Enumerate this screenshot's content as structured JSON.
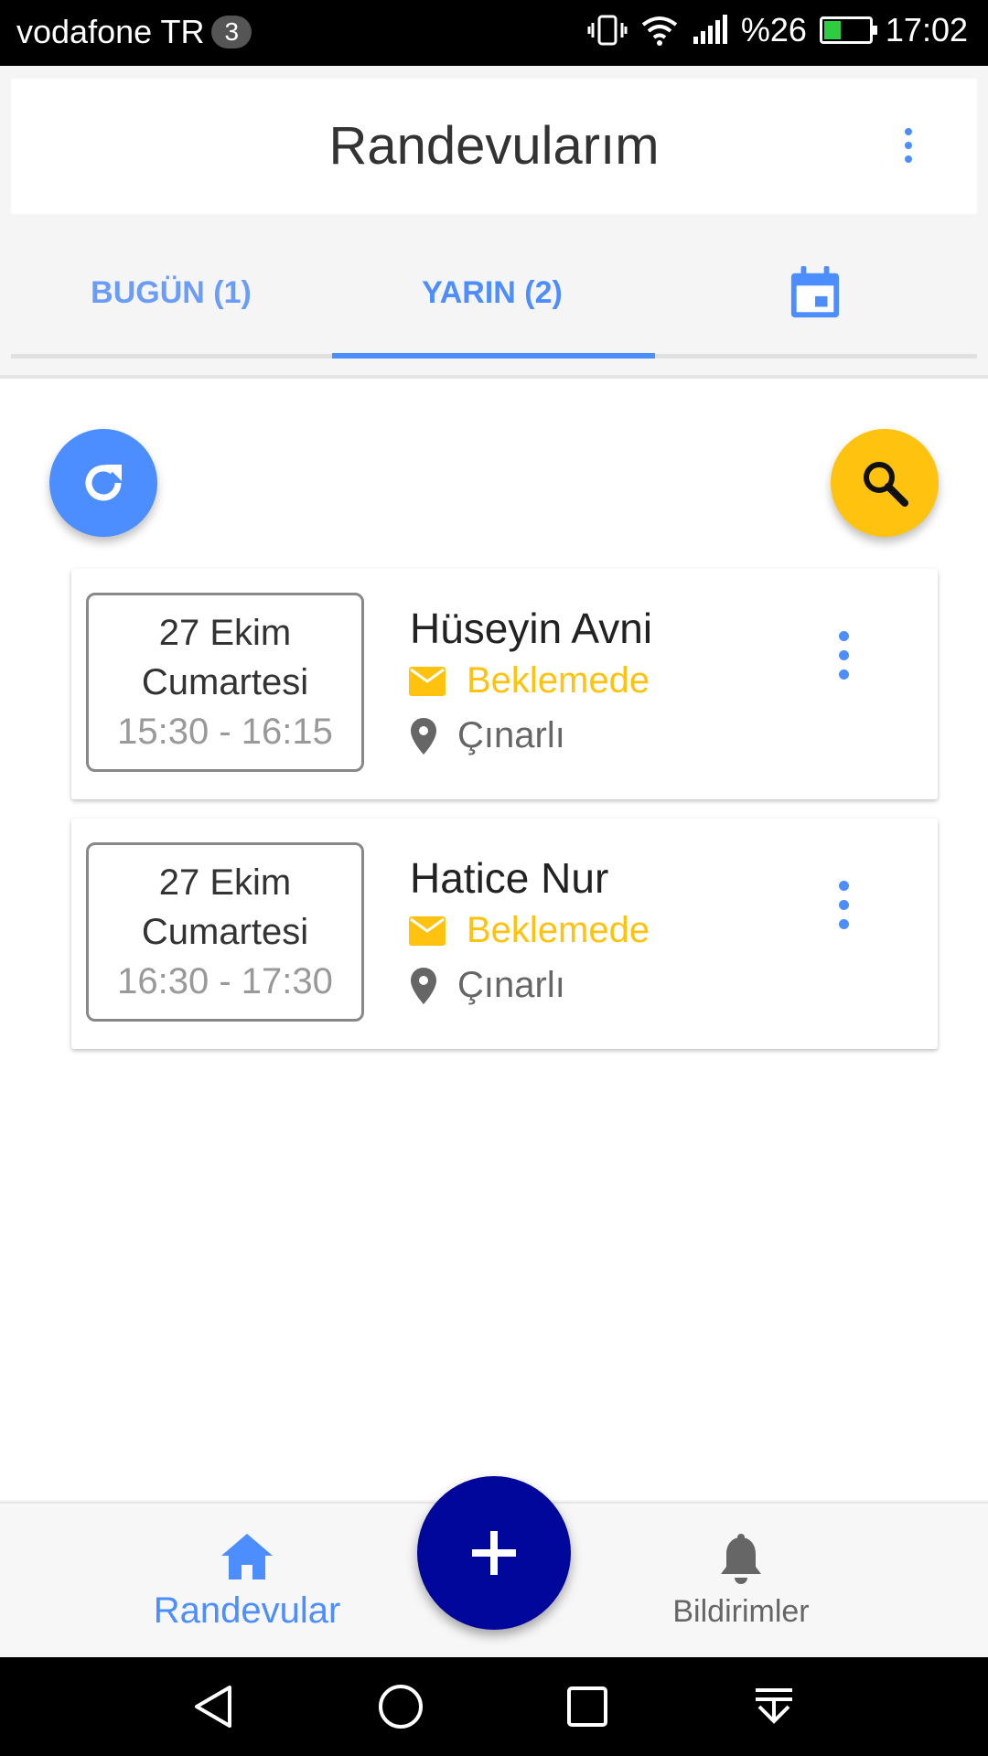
{
  "status_bar": {
    "carrier": "vodafone TR",
    "sim_badge": "3",
    "battery": "%26",
    "time": "17:02",
    "battery_level": 0.26
  },
  "app_bar": {
    "title": "Randevularım"
  },
  "tabs": [
    {
      "label": "BUGÜN (1)",
      "selected": false
    },
    {
      "label": "YARIN (2)",
      "selected": true
    },
    {
      "icon": "calendar-icon",
      "selected": false
    }
  ],
  "actions": {
    "refresh_icon": "refresh-icon",
    "search_icon": "search-icon"
  },
  "appointments": [
    {
      "date": "27 Ekim",
      "day": "Cumartesi",
      "time": "15:30 - 16:15",
      "name": "Hüseyin Avni",
      "status": "Beklemede",
      "location": "Çınarlı"
    },
    {
      "date": "27 Ekim",
      "day": "Cumartesi",
      "time": "16:30 - 17:30",
      "name": "Hatice Nur",
      "status": "Beklemede",
      "location": "Çınarlı"
    }
  ],
  "bottom_nav": {
    "home_label": "Randevular",
    "notifications_label": "Bildirimler"
  },
  "colors": {
    "accent": "#4c8dff",
    "warning": "#ffc20e",
    "fab": "#00079a"
  }
}
